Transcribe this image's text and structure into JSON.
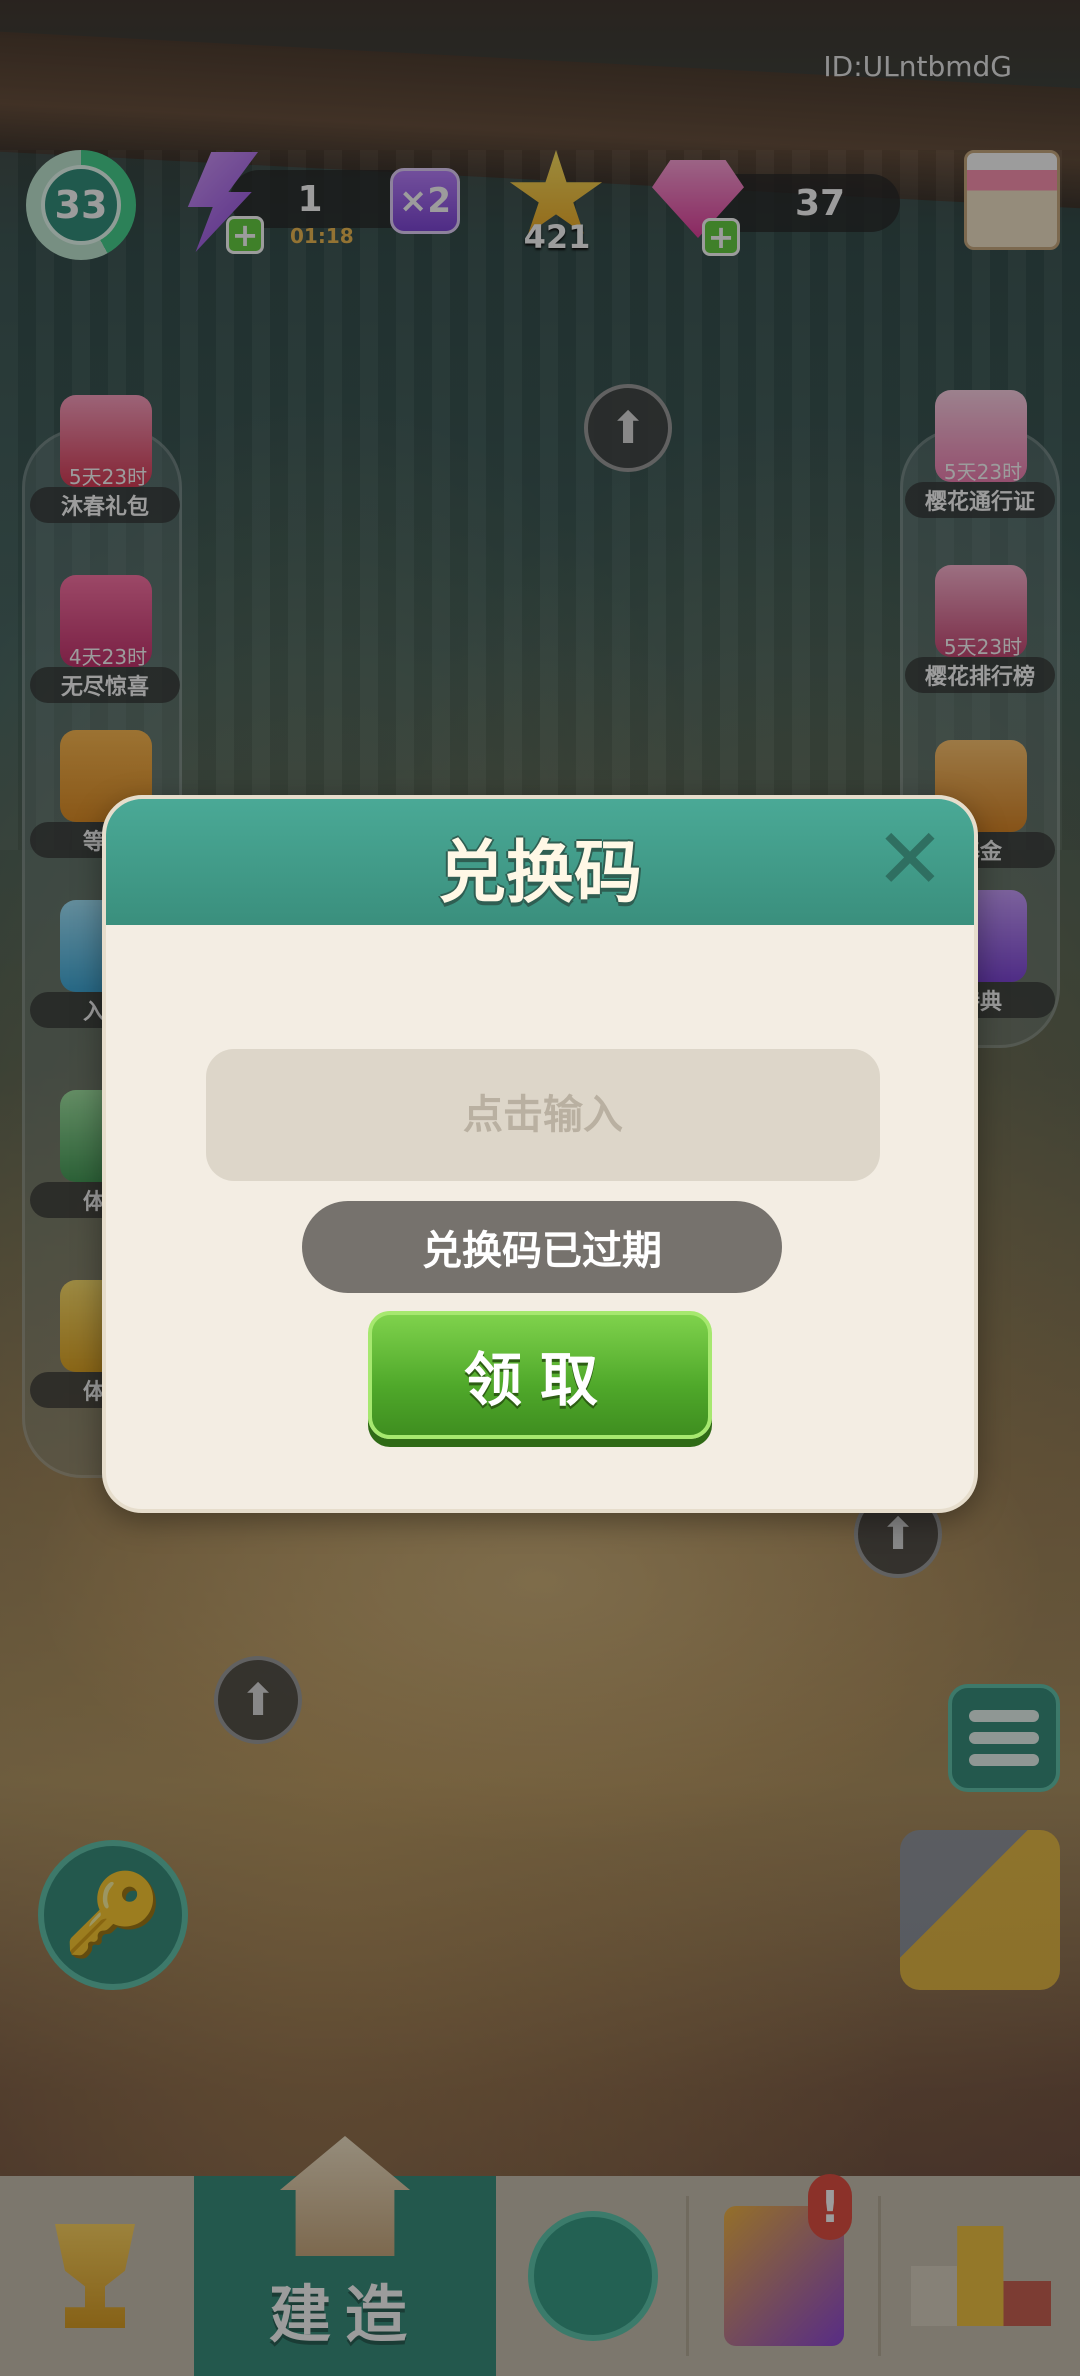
{
  "hud": {
    "user_id": "ID:ULntbmdG",
    "level": "33",
    "energy_count": "1",
    "energy_timer": "01:18",
    "multiplier": "×2",
    "star_count": "421",
    "gem_count": "37",
    "plus_symbol": "+"
  },
  "left_events": [
    {
      "timer": "5天23时",
      "label": "沐春礼包"
    },
    {
      "timer": "4天23时",
      "label": "无尽惊喜"
    },
    {
      "timer": "",
      "label": "等级"
    },
    {
      "timer": "",
      "label": "入群"
    },
    {
      "timer": "",
      "label": "体力"
    },
    {
      "timer": "",
      "label": "体验"
    }
  ],
  "right_events": [
    {
      "timer": "5天23时",
      "label": "樱花通行证"
    },
    {
      "timer": "5天23时",
      "label": "樱花排行榜"
    },
    {
      "timer": "",
      "label": "基金"
    },
    {
      "timer": "",
      "label": "特典"
    }
  ],
  "dialog": {
    "title": "兑换码",
    "close_symbol": "✕",
    "input_placeholder": "点击输入",
    "status": "兑换码已过期",
    "claim_label": "领取"
  },
  "bottom_nav": {
    "build_label": "建造",
    "alert_symbol": "!"
  },
  "icons": {
    "arrow_up": "⬆",
    "key": "🔑"
  },
  "colors": {
    "dialog_header": "#3a8f7d",
    "claim_button": "#4fa82a",
    "status_pill": "#76726d",
    "dialog_body": "#f3ede3"
  }
}
